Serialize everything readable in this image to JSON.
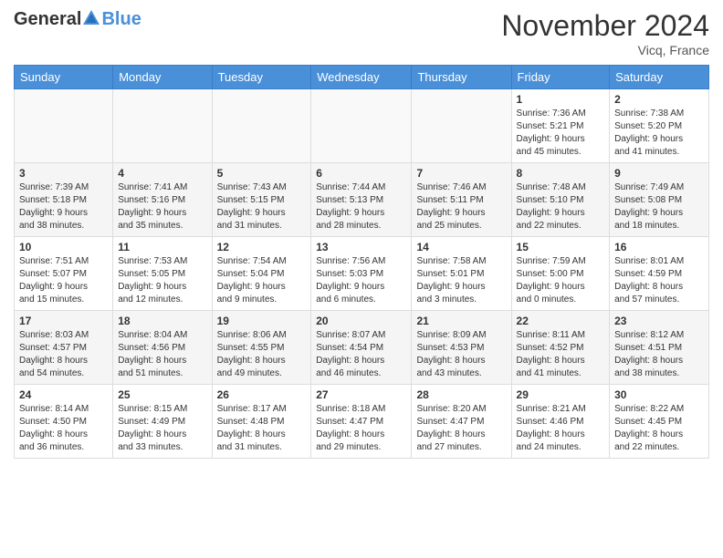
{
  "header": {
    "logo_general": "General",
    "logo_blue": "Blue",
    "month_title": "November 2024",
    "location": "Vicq, France"
  },
  "weekdays": [
    "Sunday",
    "Monday",
    "Tuesday",
    "Wednesday",
    "Thursday",
    "Friday",
    "Saturday"
  ],
  "weeks": [
    [
      {
        "day": "",
        "info": ""
      },
      {
        "day": "",
        "info": ""
      },
      {
        "day": "",
        "info": ""
      },
      {
        "day": "",
        "info": ""
      },
      {
        "day": "",
        "info": ""
      },
      {
        "day": "1",
        "info": "Sunrise: 7:36 AM\nSunset: 5:21 PM\nDaylight: 9 hours\nand 45 minutes."
      },
      {
        "day": "2",
        "info": "Sunrise: 7:38 AM\nSunset: 5:20 PM\nDaylight: 9 hours\nand 41 minutes."
      }
    ],
    [
      {
        "day": "3",
        "info": "Sunrise: 7:39 AM\nSunset: 5:18 PM\nDaylight: 9 hours\nand 38 minutes."
      },
      {
        "day": "4",
        "info": "Sunrise: 7:41 AM\nSunset: 5:16 PM\nDaylight: 9 hours\nand 35 minutes."
      },
      {
        "day": "5",
        "info": "Sunrise: 7:43 AM\nSunset: 5:15 PM\nDaylight: 9 hours\nand 31 minutes."
      },
      {
        "day": "6",
        "info": "Sunrise: 7:44 AM\nSunset: 5:13 PM\nDaylight: 9 hours\nand 28 minutes."
      },
      {
        "day": "7",
        "info": "Sunrise: 7:46 AM\nSunset: 5:11 PM\nDaylight: 9 hours\nand 25 minutes."
      },
      {
        "day": "8",
        "info": "Sunrise: 7:48 AM\nSunset: 5:10 PM\nDaylight: 9 hours\nand 22 minutes."
      },
      {
        "day": "9",
        "info": "Sunrise: 7:49 AM\nSunset: 5:08 PM\nDaylight: 9 hours\nand 18 minutes."
      }
    ],
    [
      {
        "day": "10",
        "info": "Sunrise: 7:51 AM\nSunset: 5:07 PM\nDaylight: 9 hours\nand 15 minutes."
      },
      {
        "day": "11",
        "info": "Sunrise: 7:53 AM\nSunset: 5:05 PM\nDaylight: 9 hours\nand 12 minutes."
      },
      {
        "day": "12",
        "info": "Sunrise: 7:54 AM\nSunset: 5:04 PM\nDaylight: 9 hours\nand 9 minutes."
      },
      {
        "day": "13",
        "info": "Sunrise: 7:56 AM\nSunset: 5:03 PM\nDaylight: 9 hours\nand 6 minutes."
      },
      {
        "day": "14",
        "info": "Sunrise: 7:58 AM\nSunset: 5:01 PM\nDaylight: 9 hours\nand 3 minutes."
      },
      {
        "day": "15",
        "info": "Sunrise: 7:59 AM\nSunset: 5:00 PM\nDaylight: 9 hours\nand 0 minutes."
      },
      {
        "day": "16",
        "info": "Sunrise: 8:01 AM\nSunset: 4:59 PM\nDaylight: 8 hours\nand 57 minutes."
      }
    ],
    [
      {
        "day": "17",
        "info": "Sunrise: 8:03 AM\nSunset: 4:57 PM\nDaylight: 8 hours\nand 54 minutes."
      },
      {
        "day": "18",
        "info": "Sunrise: 8:04 AM\nSunset: 4:56 PM\nDaylight: 8 hours\nand 51 minutes."
      },
      {
        "day": "19",
        "info": "Sunrise: 8:06 AM\nSunset: 4:55 PM\nDaylight: 8 hours\nand 49 minutes."
      },
      {
        "day": "20",
        "info": "Sunrise: 8:07 AM\nSunset: 4:54 PM\nDaylight: 8 hours\nand 46 minutes."
      },
      {
        "day": "21",
        "info": "Sunrise: 8:09 AM\nSunset: 4:53 PM\nDaylight: 8 hours\nand 43 minutes."
      },
      {
        "day": "22",
        "info": "Sunrise: 8:11 AM\nSunset: 4:52 PM\nDaylight: 8 hours\nand 41 minutes."
      },
      {
        "day": "23",
        "info": "Sunrise: 8:12 AM\nSunset: 4:51 PM\nDaylight: 8 hours\nand 38 minutes."
      }
    ],
    [
      {
        "day": "24",
        "info": "Sunrise: 8:14 AM\nSunset: 4:50 PM\nDaylight: 8 hours\nand 36 minutes."
      },
      {
        "day": "25",
        "info": "Sunrise: 8:15 AM\nSunset: 4:49 PM\nDaylight: 8 hours\nand 33 minutes."
      },
      {
        "day": "26",
        "info": "Sunrise: 8:17 AM\nSunset: 4:48 PM\nDaylight: 8 hours\nand 31 minutes."
      },
      {
        "day": "27",
        "info": "Sunrise: 8:18 AM\nSunset: 4:47 PM\nDaylight: 8 hours\nand 29 minutes."
      },
      {
        "day": "28",
        "info": "Sunrise: 8:20 AM\nSunset: 4:47 PM\nDaylight: 8 hours\nand 27 minutes."
      },
      {
        "day": "29",
        "info": "Sunrise: 8:21 AM\nSunset: 4:46 PM\nDaylight: 8 hours\nand 24 minutes."
      },
      {
        "day": "30",
        "info": "Sunrise: 8:22 AM\nSunset: 4:45 PM\nDaylight: 8 hours\nand 22 minutes."
      }
    ]
  ]
}
